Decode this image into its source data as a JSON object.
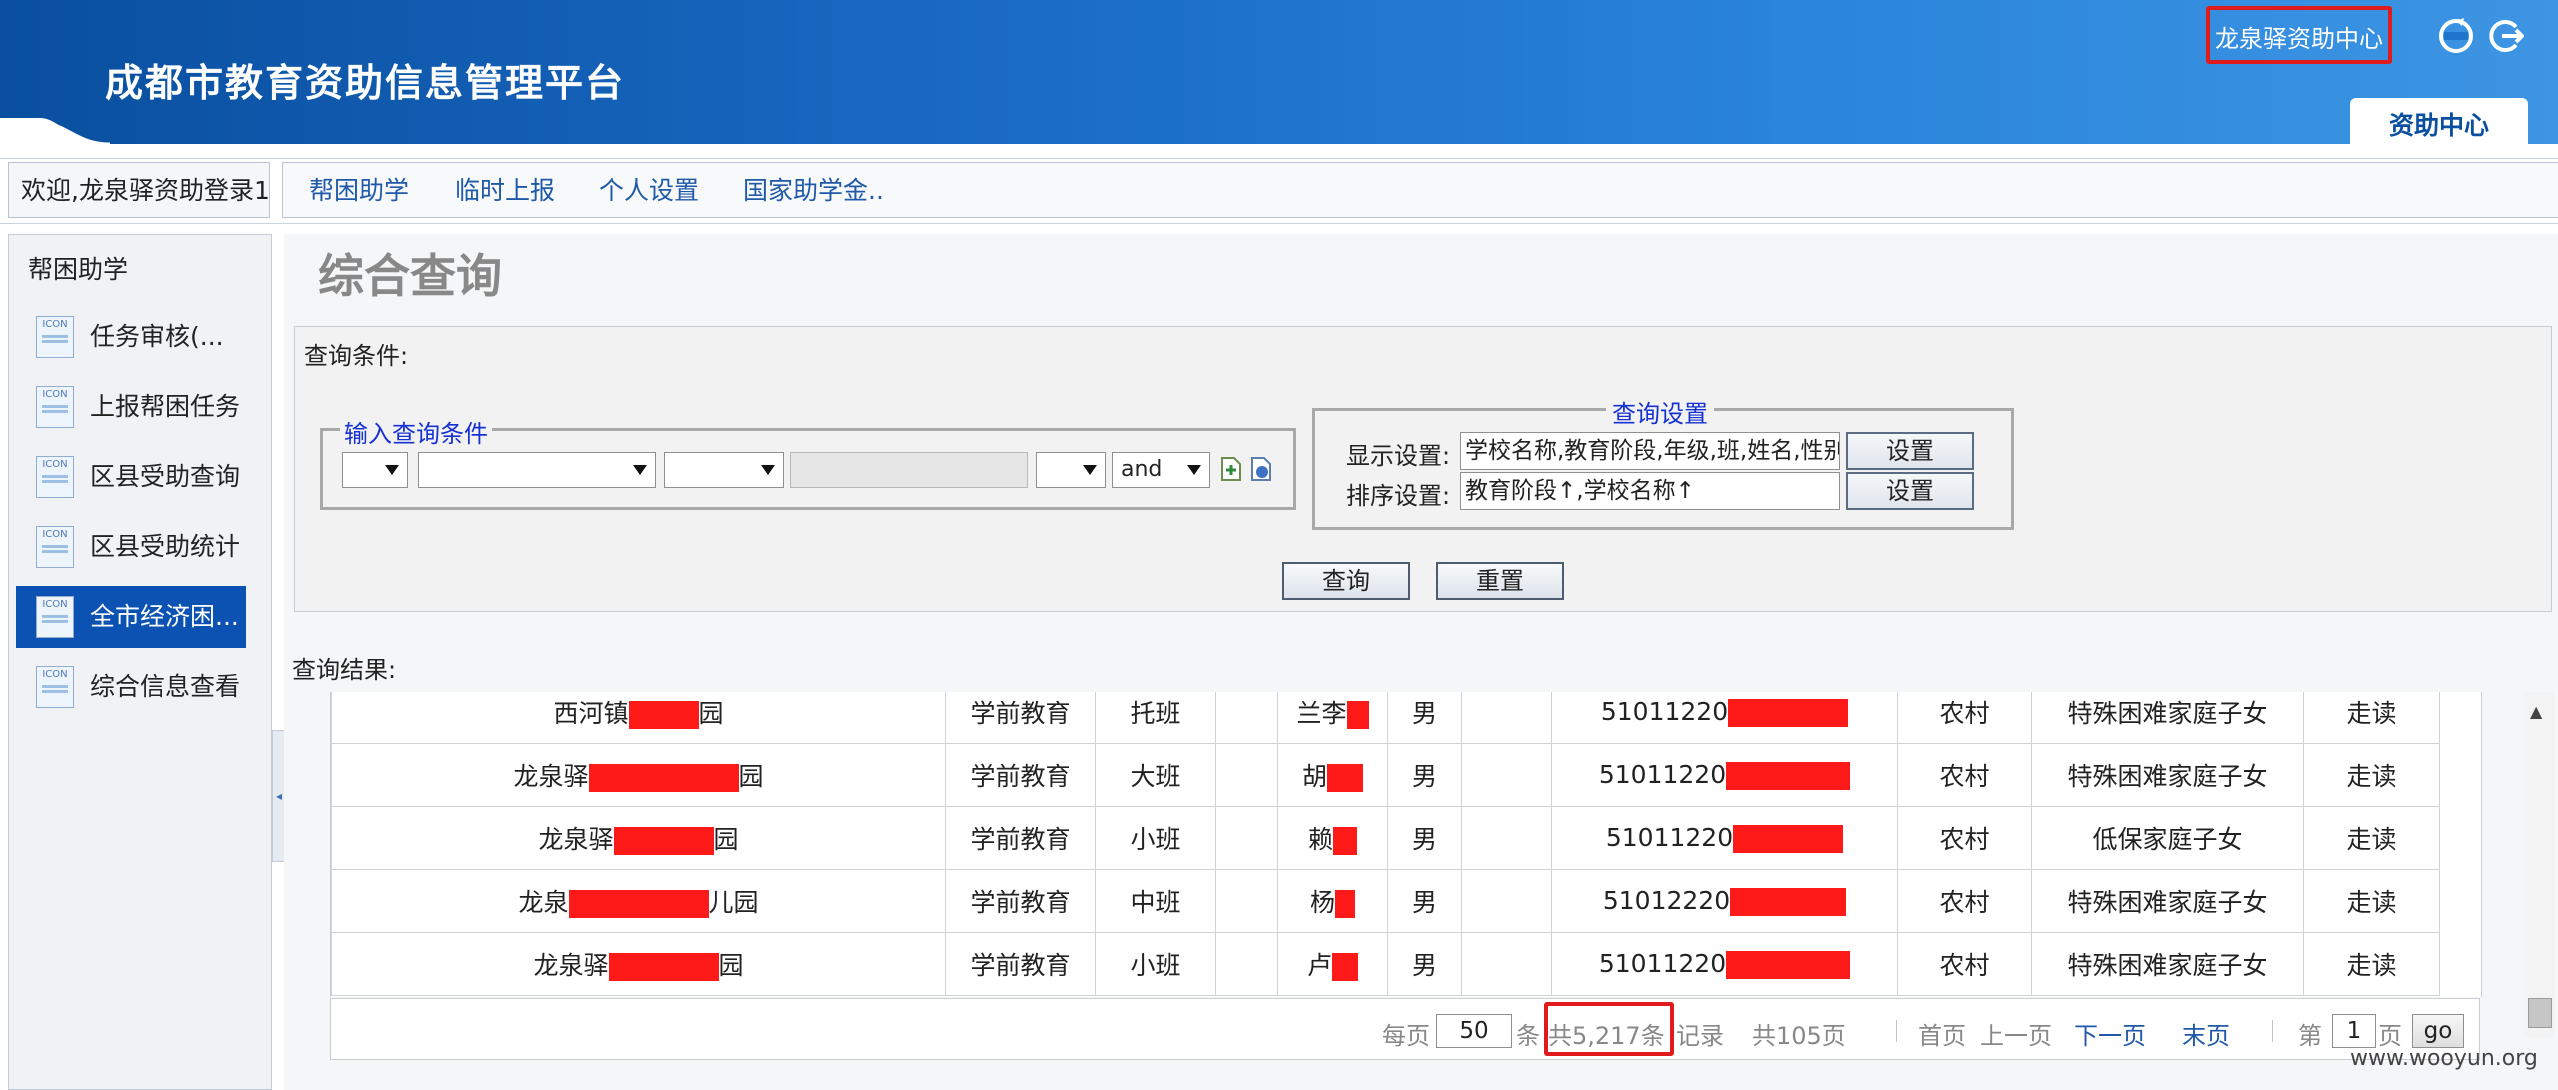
{
  "header": {
    "app_title": "成都市教育资助信息管理平台",
    "center_name": "龙泉驿资助中心",
    "tab_label": "资助中心",
    "icons": [
      "refresh-icon",
      "logout-icon"
    ]
  },
  "menubar": {
    "welcome": "欢迎,龙泉驿资助登录1",
    "items": [
      "帮困助学",
      "临时上报",
      "个人设置",
      "国家助学金.."
    ]
  },
  "sidebar": {
    "title": "帮困助学",
    "icon_text": "ICON",
    "items": [
      {
        "label": "任务审核(..."
      },
      {
        "label": "上报帮困任务"
      },
      {
        "label": "区县受助查询"
      },
      {
        "label": "区县受助统计"
      },
      {
        "label": "全市经济困...",
        "active": true
      },
      {
        "label": "综合信息查看"
      }
    ]
  },
  "main": {
    "page_title": "综合查询",
    "query_conditions_label": "查询条件:",
    "input_legend": "输入查询条件",
    "logic_select": "and",
    "settings_legend": "查询设置",
    "display_label": "显示设置:",
    "display_value": "学校名称,教育阶段,年级,班,姓名,性别",
    "sort_label": "排序设置:",
    "sort_value": "教育阶段↑,学校名称↑",
    "set_button": "设置",
    "query_button": "查询",
    "reset_button": "重置",
    "results_label": "查询结果:"
  },
  "results": {
    "rows": [
      {
        "school": "西河镇",
        "school_end": "园",
        "stage": "学前教育",
        "grade": "托班",
        "name": "兰李",
        "gender": "男",
        "id": "51011220",
        "area": "农村",
        "category": "特殊困难家庭子女",
        "boarding": "走读"
      },
      {
        "school": "龙泉驿",
        "school_end": "园",
        "stage": "学前教育",
        "grade": "大班",
        "name": "胡",
        "gender": "男",
        "id": "51011220",
        "area": "农村",
        "category": "特殊困难家庭子女",
        "boarding": "走读"
      },
      {
        "school": "龙泉驿",
        "school_end": "园",
        "stage": "学前教育",
        "grade": "小班",
        "name": "赖",
        "gender": "男",
        "id": "51011220",
        "area": "农村",
        "category": "低保家庭子女",
        "boarding": "走读"
      },
      {
        "school": "龙泉",
        "school_end": "儿园",
        "stage": "学前教育",
        "grade": "中班",
        "name": "杨",
        "gender": "男",
        "id": "51012220",
        "area": "农村",
        "category": "特殊困难家庭子女",
        "boarding": "走读"
      },
      {
        "school": "龙泉驿",
        "school_end": "园",
        "stage": "学前教育",
        "grade": "小班",
        "name": "卢",
        "gender": "男",
        "id": "51011220",
        "area": "农村",
        "category": "特殊困难家庭子女",
        "boarding": "走读"
      }
    ]
  },
  "pager": {
    "per_page_prefix": "每页",
    "per_page": "50",
    "per_page_suffix": "条",
    "total_records": "共5,217条",
    "records_suffix": "记录",
    "total_pages": "共105页",
    "first": "首页",
    "prev": "上一页",
    "next": "下一页",
    "last": "末页",
    "page_prefix": "第",
    "current_page": "1",
    "page_suffix": "页",
    "go": "go"
  },
  "watermark": "www.wooyun.org",
  "colors": {
    "header_blue": "#1a6bc6",
    "active_sidebar": "#0b52b3",
    "link_blue": "#1f59a8",
    "legend_blue": "#1631d1",
    "highlight_red": "#e11b1b",
    "redaction_red": "#ff1a1a"
  }
}
